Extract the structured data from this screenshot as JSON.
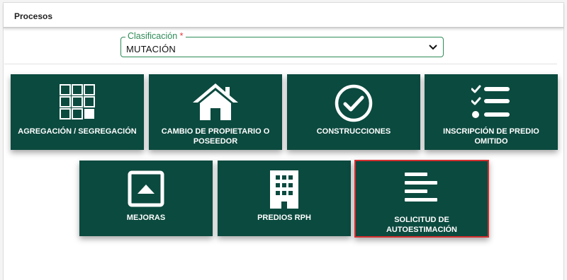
{
  "panel": {
    "title": "Procesos"
  },
  "clasificacion": {
    "label": "Clasificación",
    "required_mark": "*",
    "value": "MUTACIÓN"
  },
  "cards": [
    {
      "label": "AGREGACIÓN / SEGREGACIÓN"
    },
    {
      "label": "CAMBIO DE PROPIETARIO O POSEEDOR"
    },
    {
      "label": "CONSTRUCCIONES"
    },
    {
      "label": "INSCRIPCIÓN DE PREDIO OMITIDO"
    },
    {
      "label": "MEJORAS"
    },
    {
      "label": "PREDIOS RPH"
    },
    {
      "label": "SOLICITUD DE AUTOESTIMACIÓN"
    }
  ],
  "colors": {
    "card_bg": "#0b4a3f",
    "accent": "#2e8b57",
    "selected_border": "#d32f2f"
  }
}
